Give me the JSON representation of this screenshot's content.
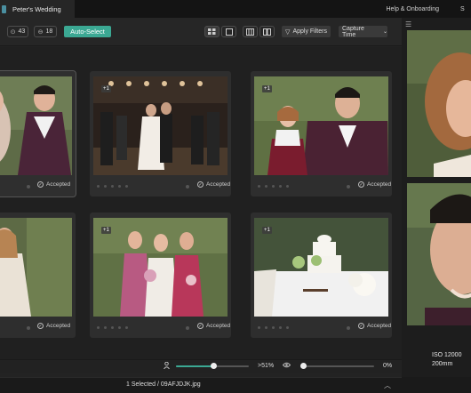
{
  "tab": {
    "title": "Peter's Wedding"
  },
  "top_right": {
    "help": "Help & Onboarding",
    "next": "S"
  },
  "toolbar": {
    "count_all": "43",
    "count_selected": "18",
    "auto_select": "Auto-Select",
    "apply_filters": "Apply Filters",
    "sort": "Capture Time",
    "sort_chevron": "⌄",
    "count_all_icon": "⊙",
    "count_selected_icon": "⊖",
    "filter_icon": "▽"
  },
  "cards": [
    {
      "status": "Accepted",
      "badge": ""
    },
    {
      "status": "Accepted",
      "badge": "+1"
    },
    {
      "status": "Accepted",
      "badge": "+1"
    },
    {
      "status": "Accepted",
      "badge": ""
    },
    {
      "status": "Accepted",
      "badge": "+1"
    },
    {
      "status": "Accepted",
      "badge": "+1"
    }
  ],
  "accepted_check": "✓",
  "right_panel": {
    "iso": "ISO 12000",
    "focal": "200mm",
    "menu_icon": "☰"
  },
  "sliders": {
    "left_value": ">51%",
    "left_fill": 0.51,
    "right_value": "0%",
    "right_fill": 0,
    "person_icon": "person-icon",
    "eye_icon": "eye-icon"
  },
  "status": {
    "selection": "1 Selected / 09AFJDJK.jpg",
    "expand": "︿"
  },
  "colors": {
    "accent": "#3ba893"
  }
}
